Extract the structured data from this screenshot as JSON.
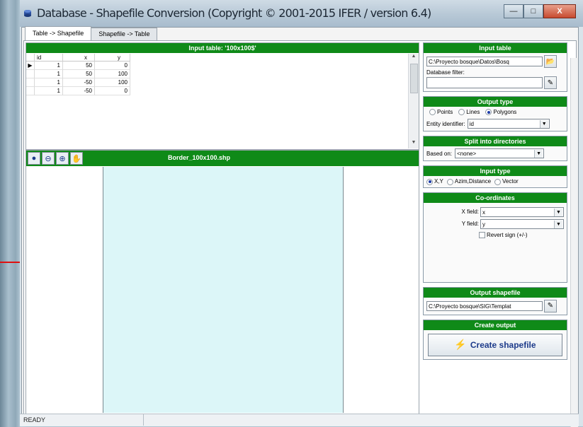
{
  "window": {
    "title": "Database - Shapefile Conversion (Copyright © 2001-2015 IFER / version 6.4)"
  },
  "tabs": [
    {
      "label": "Table -> Shapefile",
      "active": true
    },
    {
      "label": "Shapefile -> Table",
      "active": false
    }
  ],
  "input_table": {
    "header": "Input table: '100x100$'",
    "columns": [
      "id",
      "x",
      "y"
    ],
    "rows": [
      {
        "id": "1",
        "x": "50",
        "y": "0"
      },
      {
        "id": "1",
        "x": "50",
        "y": "100"
      },
      {
        "id": "1",
        "x": "-50",
        "y": "100"
      },
      {
        "id": "1",
        "x": "-50",
        "y": "0"
      }
    ]
  },
  "map": {
    "title": "Border_100x100.shp",
    "tools": [
      "globe-icon",
      "zoom-out-icon",
      "zoom-in-icon",
      "pan-icon"
    ]
  },
  "panel": {
    "input_table": {
      "header": "Input table",
      "path": "C:\\Proyecto bosque\\Datos\\Bosq",
      "filter_label": "Database filter:",
      "filter_value": ""
    },
    "output_type": {
      "header": "Output type",
      "options": [
        "Points",
        "Lines",
        "Polygons"
      ],
      "selected": "Polygons",
      "entity_label": "Entity identifier:",
      "entity_value": "id"
    },
    "split": {
      "header": "Split into directories",
      "based_label": "Based on:",
      "based_value": "<none>"
    },
    "input_type": {
      "header": "Input type",
      "options": [
        "X,Y",
        "Azim,Distance",
        "Vector"
      ],
      "selected": "X,Y"
    },
    "coordinates": {
      "header": "Co-ordinates",
      "x_label": "X field:",
      "x_value": "x",
      "y_label": "Y field:",
      "y_value": "y",
      "revert_label": "Revert sign (+/-)"
    },
    "output_shapefile": {
      "header": "Output shapefile",
      "path": "C:\\Proyecto bosque\\SIG\\Templat"
    },
    "create_output": {
      "header": "Create output",
      "button_label": "Create shapefile"
    }
  },
  "status": {
    "text": "READY"
  }
}
